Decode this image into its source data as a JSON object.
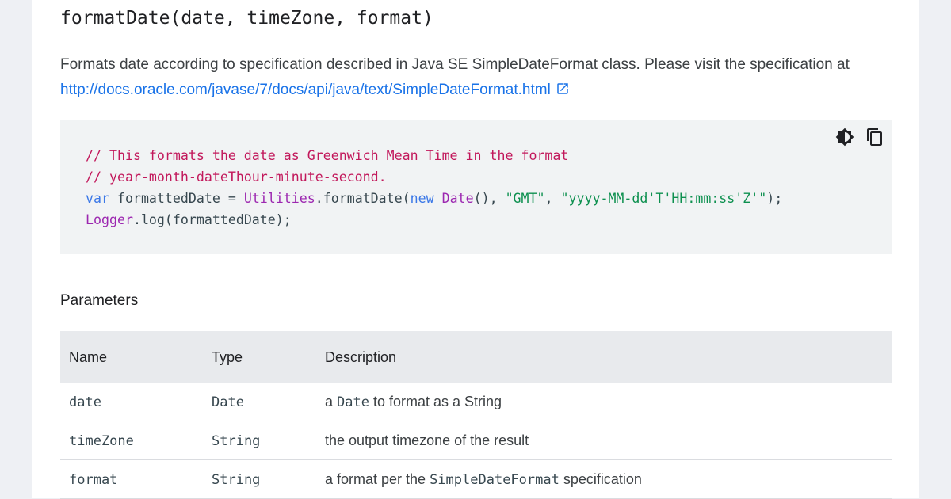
{
  "method": {
    "signature": "formatDate(date, timeZone, format)"
  },
  "description": {
    "text": "Formats date according to specification described in Java SE SimpleDateFormat class. Please visit the specification at ",
    "link_text": "http://docs.oracle.com/javase/7/docs/api/java/text/SimpleDateFormat.html",
    "link_icon": "external-link-icon",
    "link_color": "#1a73e8"
  },
  "code_block": {
    "tools": [
      "dark-theme-toggle-icon",
      "copy-icon"
    ],
    "lines": {
      "l1_comment": "// This formats the date as Greenwich Mean Time in the format",
      "l2_comment": "// year-month-dateThour-minute-second.",
      "l3_kw_var": "var",
      "l3_ident": " formattedDate = ",
      "l3_type_utilities": "Utilities",
      "l3_method": ".formatDate(",
      "l3_kw_new": "new",
      "l3_space": " ",
      "l3_type_date": "Date",
      "l3_args_sep1": "(), ",
      "l3_str_gmt": "\"GMT\"",
      "l3_args_sep2": ", ",
      "l3_str_format": "\"yyyy-MM-dd'T'HH:mm:ss'Z'\"",
      "l3_end": ");",
      "l4_type_logger": "Logger",
      "l4_rest": ".log(formattedDate);"
    },
    "colors": {
      "comment": "#c2185b",
      "keyword": "#3b78e7",
      "type": "#9c27b0",
      "string": "#0d904f"
    }
  },
  "parameters": {
    "heading": "Parameters",
    "columns": [
      "Name",
      "Type",
      "Description"
    ],
    "rows": [
      {
        "name": "date",
        "type": "Date",
        "desc_pre": "a ",
        "desc_code": "Date",
        "desc_post": " to format as a String"
      },
      {
        "name": "timeZone",
        "type": "String",
        "desc_pre": "the output timezone of the result",
        "desc_code": "",
        "desc_post": ""
      },
      {
        "name": "format",
        "type": "String",
        "desc_pre": "a format per the ",
        "desc_code": "SimpleDateFormat",
        "desc_post": " specification"
      }
    ]
  }
}
